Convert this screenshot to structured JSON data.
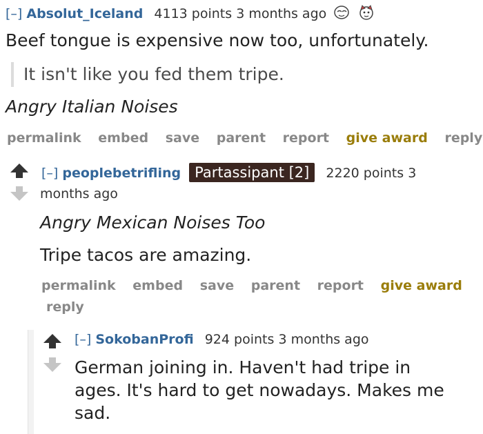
{
  "comment1": {
    "toggle": "[–]",
    "author": "Absolut_Iceland",
    "points": "4113 points",
    "time": "3 months ago",
    "body": "Beef tongue is expensive now too, unfortunately.",
    "quote": "It isn't like you fed them tripe.",
    "italic_line": "Angry Italian Noises",
    "buttons": [
      "permalink",
      "embed",
      "save",
      "parent",
      "report",
      "give award",
      "reply"
    ]
  },
  "comment2": {
    "toggle": "[–]",
    "author": "peoplebetrifling",
    "flair": "Partassipant [2]",
    "points": "2220 points 3",
    "time": "months ago",
    "italic_line": "Angry Mexican Noises Too",
    "body": "Tripe tacos are amazing.",
    "buttons": [
      "permalink",
      "embed",
      "save",
      "parent",
      "report",
      "give award"
    ],
    "reply": "reply"
  },
  "comment3": {
    "toggle": "[–]",
    "author": "SokobanProfi",
    "points": "924 points",
    "time": "3 months ago",
    "body_lines": [
      "German joining in. Haven't had tripe in",
      "ages. It's hard to get nowadays. Makes me",
      "sad."
    ]
  },
  "icons": [
    "award-face-icon",
    "award-cat-icon",
    "upvote-arrow-icon",
    "downvote-arrow-icon"
  ]
}
